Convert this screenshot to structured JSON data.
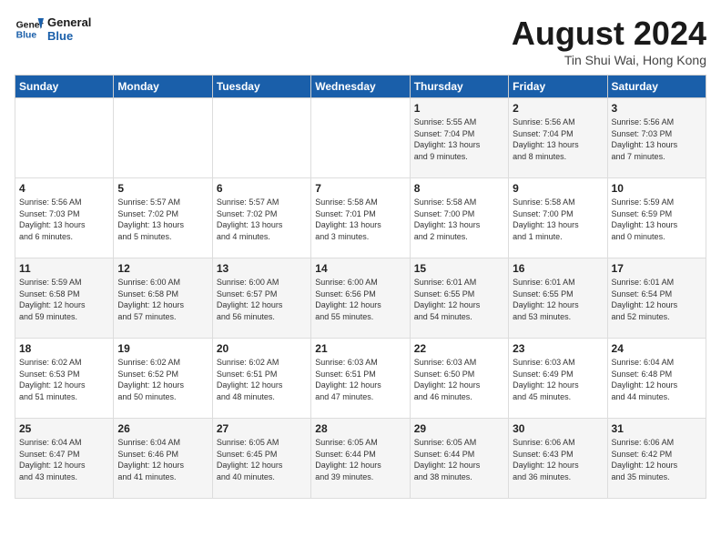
{
  "logo": {
    "line1": "General",
    "line2": "Blue"
  },
  "title": "August 2024",
  "subtitle": "Tin Shui Wai, Hong Kong",
  "days_of_week": [
    "Sunday",
    "Monday",
    "Tuesday",
    "Wednesday",
    "Thursday",
    "Friday",
    "Saturday"
  ],
  "weeks": [
    [
      {
        "day": "",
        "info": ""
      },
      {
        "day": "",
        "info": ""
      },
      {
        "day": "",
        "info": ""
      },
      {
        "day": "",
        "info": ""
      },
      {
        "day": "1",
        "info": "Sunrise: 5:55 AM\nSunset: 7:04 PM\nDaylight: 13 hours\nand 9 minutes."
      },
      {
        "day": "2",
        "info": "Sunrise: 5:56 AM\nSunset: 7:04 PM\nDaylight: 13 hours\nand 8 minutes."
      },
      {
        "day": "3",
        "info": "Sunrise: 5:56 AM\nSunset: 7:03 PM\nDaylight: 13 hours\nand 7 minutes."
      }
    ],
    [
      {
        "day": "4",
        "info": "Sunrise: 5:56 AM\nSunset: 7:03 PM\nDaylight: 13 hours\nand 6 minutes."
      },
      {
        "day": "5",
        "info": "Sunrise: 5:57 AM\nSunset: 7:02 PM\nDaylight: 13 hours\nand 5 minutes."
      },
      {
        "day": "6",
        "info": "Sunrise: 5:57 AM\nSunset: 7:02 PM\nDaylight: 13 hours\nand 4 minutes."
      },
      {
        "day": "7",
        "info": "Sunrise: 5:58 AM\nSunset: 7:01 PM\nDaylight: 13 hours\nand 3 minutes."
      },
      {
        "day": "8",
        "info": "Sunrise: 5:58 AM\nSunset: 7:00 PM\nDaylight: 13 hours\nand 2 minutes."
      },
      {
        "day": "9",
        "info": "Sunrise: 5:58 AM\nSunset: 7:00 PM\nDaylight: 13 hours\nand 1 minute."
      },
      {
        "day": "10",
        "info": "Sunrise: 5:59 AM\nSunset: 6:59 PM\nDaylight: 13 hours\nand 0 minutes."
      }
    ],
    [
      {
        "day": "11",
        "info": "Sunrise: 5:59 AM\nSunset: 6:58 PM\nDaylight: 12 hours\nand 59 minutes."
      },
      {
        "day": "12",
        "info": "Sunrise: 6:00 AM\nSunset: 6:58 PM\nDaylight: 12 hours\nand 57 minutes."
      },
      {
        "day": "13",
        "info": "Sunrise: 6:00 AM\nSunset: 6:57 PM\nDaylight: 12 hours\nand 56 minutes."
      },
      {
        "day": "14",
        "info": "Sunrise: 6:00 AM\nSunset: 6:56 PM\nDaylight: 12 hours\nand 55 minutes."
      },
      {
        "day": "15",
        "info": "Sunrise: 6:01 AM\nSunset: 6:55 PM\nDaylight: 12 hours\nand 54 minutes."
      },
      {
        "day": "16",
        "info": "Sunrise: 6:01 AM\nSunset: 6:55 PM\nDaylight: 12 hours\nand 53 minutes."
      },
      {
        "day": "17",
        "info": "Sunrise: 6:01 AM\nSunset: 6:54 PM\nDaylight: 12 hours\nand 52 minutes."
      }
    ],
    [
      {
        "day": "18",
        "info": "Sunrise: 6:02 AM\nSunset: 6:53 PM\nDaylight: 12 hours\nand 51 minutes."
      },
      {
        "day": "19",
        "info": "Sunrise: 6:02 AM\nSunset: 6:52 PM\nDaylight: 12 hours\nand 50 minutes."
      },
      {
        "day": "20",
        "info": "Sunrise: 6:02 AM\nSunset: 6:51 PM\nDaylight: 12 hours\nand 48 minutes."
      },
      {
        "day": "21",
        "info": "Sunrise: 6:03 AM\nSunset: 6:51 PM\nDaylight: 12 hours\nand 47 minutes."
      },
      {
        "day": "22",
        "info": "Sunrise: 6:03 AM\nSunset: 6:50 PM\nDaylight: 12 hours\nand 46 minutes."
      },
      {
        "day": "23",
        "info": "Sunrise: 6:03 AM\nSunset: 6:49 PM\nDaylight: 12 hours\nand 45 minutes."
      },
      {
        "day": "24",
        "info": "Sunrise: 6:04 AM\nSunset: 6:48 PM\nDaylight: 12 hours\nand 44 minutes."
      }
    ],
    [
      {
        "day": "25",
        "info": "Sunrise: 6:04 AM\nSunset: 6:47 PM\nDaylight: 12 hours\nand 43 minutes."
      },
      {
        "day": "26",
        "info": "Sunrise: 6:04 AM\nSunset: 6:46 PM\nDaylight: 12 hours\nand 41 minutes."
      },
      {
        "day": "27",
        "info": "Sunrise: 6:05 AM\nSunset: 6:45 PM\nDaylight: 12 hours\nand 40 minutes."
      },
      {
        "day": "28",
        "info": "Sunrise: 6:05 AM\nSunset: 6:44 PM\nDaylight: 12 hours\nand 39 minutes."
      },
      {
        "day": "29",
        "info": "Sunrise: 6:05 AM\nSunset: 6:44 PM\nDaylight: 12 hours\nand 38 minutes."
      },
      {
        "day": "30",
        "info": "Sunrise: 6:06 AM\nSunset: 6:43 PM\nDaylight: 12 hours\nand 36 minutes."
      },
      {
        "day": "31",
        "info": "Sunrise: 6:06 AM\nSunset: 6:42 PM\nDaylight: 12 hours\nand 35 minutes."
      }
    ]
  ]
}
